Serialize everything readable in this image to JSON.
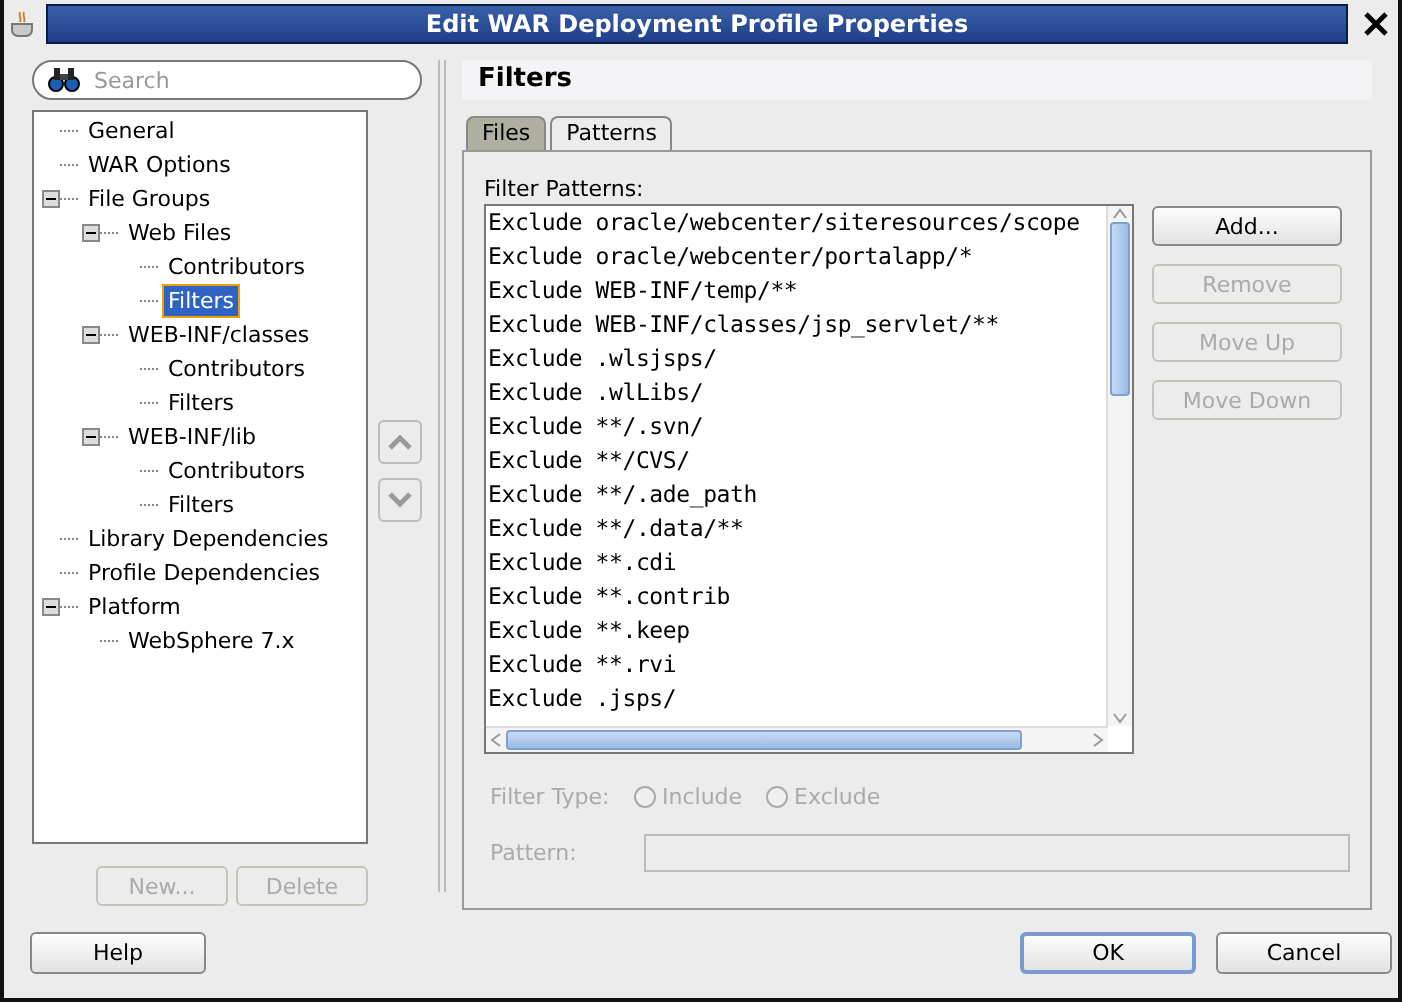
{
  "window": {
    "title": "Edit WAR Deployment Profile Properties"
  },
  "search": {
    "placeholder": "Search"
  },
  "tree": [
    {
      "label": "General",
      "selected": false
    },
    {
      "label": "WAR Options",
      "selected": false
    },
    {
      "label": "File Groups",
      "selected": false,
      "expanded": true,
      "children": [
        {
          "label": "Web Files",
          "selected": false,
          "expanded": true,
          "children": [
            {
              "label": "Contributors",
              "selected": false
            },
            {
              "label": "Filters",
              "selected": true
            }
          ]
        },
        {
          "label": "WEB-INF/classes",
          "selected": false,
          "expanded": true,
          "children": [
            {
              "label": "Contributors",
              "selected": false
            },
            {
              "label": "Filters",
              "selected": false
            }
          ]
        },
        {
          "label": "WEB-INF/lib",
          "selected": false,
          "expanded": true,
          "children": [
            {
              "label": "Contributors",
              "selected": false
            },
            {
              "label": "Filters",
              "selected": false
            }
          ]
        }
      ]
    },
    {
      "label": "Library Dependencies",
      "selected": false
    },
    {
      "label": "Profile Dependencies",
      "selected": false
    },
    {
      "label": "Platform",
      "selected": false,
      "expanded": true,
      "children": [
        {
          "label": "WebSphere 7.x",
          "selected": false
        }
      ]
    }
  ],
  "tree_buttons": [
    {
      "label": "New...",
      "disabled": true
    },
    {
      "label": "Delete",
      "disabled": true
    }
  ],
  "panel": {
    "title": "Filters"
  },
  "tabs": [
    {
      "label": "Files",
      "selected": false
    },
    {
      "label": "Patterns",
      "selected": true
    }
  ],
  "filter_patterns": {
    "label": "Filter Patterns:",
    "items": [
      "Exclude oracle/webcenter/siteresources/scope",
      "Exclude oracle/webcenter/portalapp/*",
      "Exclude WEB-INF/temp/**",
      "Exclude WEB-INF/classes/jsp_servlet/**",
      "Exclude .wlsjsps/",
      "Exclude .wlLibs/",
      "Exclude **/.svn/",
      "Exclude **/CVS/",
      "Exclude **/.ade_path",
      "Exclude **/.data/**",
      "Exclude **.cdi",
      "Exclude **.contrib",
      "Exclude **.keep",
      "Exclude **.rvi",
      "Exclude .jsps/"
    ]
  },
  "pattern_buttons": [
    {
      "label": "Add...",
      "disabled": false
    },
    {
      "label": "Remove",
      "disabled": true
    },
    {
      "label": "Move Up",
      "disabled": true
    },
    {
      "label": "Move Down",
      "disabled": true
    }
  ],
  "filter_type": {
    "label": "Filter Type:",
    "disabled": true,
    "options": [
      {
        "label": "Include",
        "checked": false
      },
      {
        "label": "Exclude",
        "checked": false
      }
    ]
  },
  "pattern": {
    "label": "Pattern:",
    "disabled": true
  },
  "footer_buttons": [
    {
      "label": "Help",
      "default": false
    },
    {
      "label": "OK",
      "default": true
    },
    {
      "label": "Cancel",
      "default": false
    }
  ]
}
